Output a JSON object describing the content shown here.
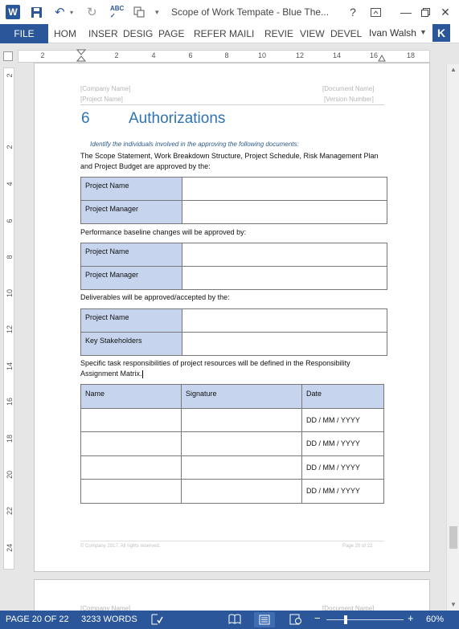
{
  "titlebar": {
    "app_icon": "word-icon",
    "title": "Scope of Work Tempate - Blue The...",
    "help_glyph": "?",
    "minimize_glyph": "—",
    "close_glyph": "✕"
  },
  "ribbon": {
    "file": "FILE",
    "tabs": [
      "HOM",
      "INSER",
      "DESIG",
      "PAGE",
      "REFER",
      "MAILI",
      "REVIE",
      "VIEW",
      "DEVEL"
    ],
    "user": "Ivan Walsh",
    "avatar": "K"
  },
  "ruler": {
    "h_labels": [
      "2",
      "2",
      "4",
      "6",
      "8",
      "10",
      "12",
      "14",
      "16",
      "18"
    ],
    "v_labels": [
      "2",
      "2",
      "4",
      "6",
      "8",
      "10",
      "12",
      "14",
      "16",
      "18",
      "20",
      "22",
      "24"
    ]
  },
  "page": {
    "header": {
      "company": "[Company Name]",
      "project": "[Project Name]",
      "document": "[Document Name]",
      "version": "[Version Number]"
    },
    "section_number": "6",
    "section_title": "Authorizations",
    "instruction": "Identify the individuals involved in the approving the following documents:",
    "para1": "The Scope Statement, Work Breakdown Structure, Project Schedule, Risk Management Plan and Project Budget are approved by the:",
    "table1": {
      "row1": "Project Name",
      "row2": "Project Manager"
    },
    "para2": "Performance baseline changes will be approved by:",
    "table2": {
      "row1": "Project Name",
      "row2": "Project Manager"
    },
    "para3": "Deliverables will be approved/accepted by the:",
    "table3": {
      "row1": "Project Name",
      "row2": "Key Stakeholders"
    },
    "para4": "Specific task responsibilities of project resources will be defined in the Responsibility Assignment Matrix.",
    "sig_table": {
      "headers": [
        "Name",
        "Signature",
        "Date"
      ],
      "date_placeholder": "DD / MM / YYYY"
    },
    "footer": {
      "copyright": "© Company 2017. All rights reserved.",
      "page": "Page 20 of 22"
    }
  },
  "page2": {
    "company": "[Company Name]",
    "document": "[Document Name]"
  },
  "statusbar": {
    "page": "PAGE 20 OF 22",
    "words": "3233 WORDS",
    "zoom": "60%"
  }
}
